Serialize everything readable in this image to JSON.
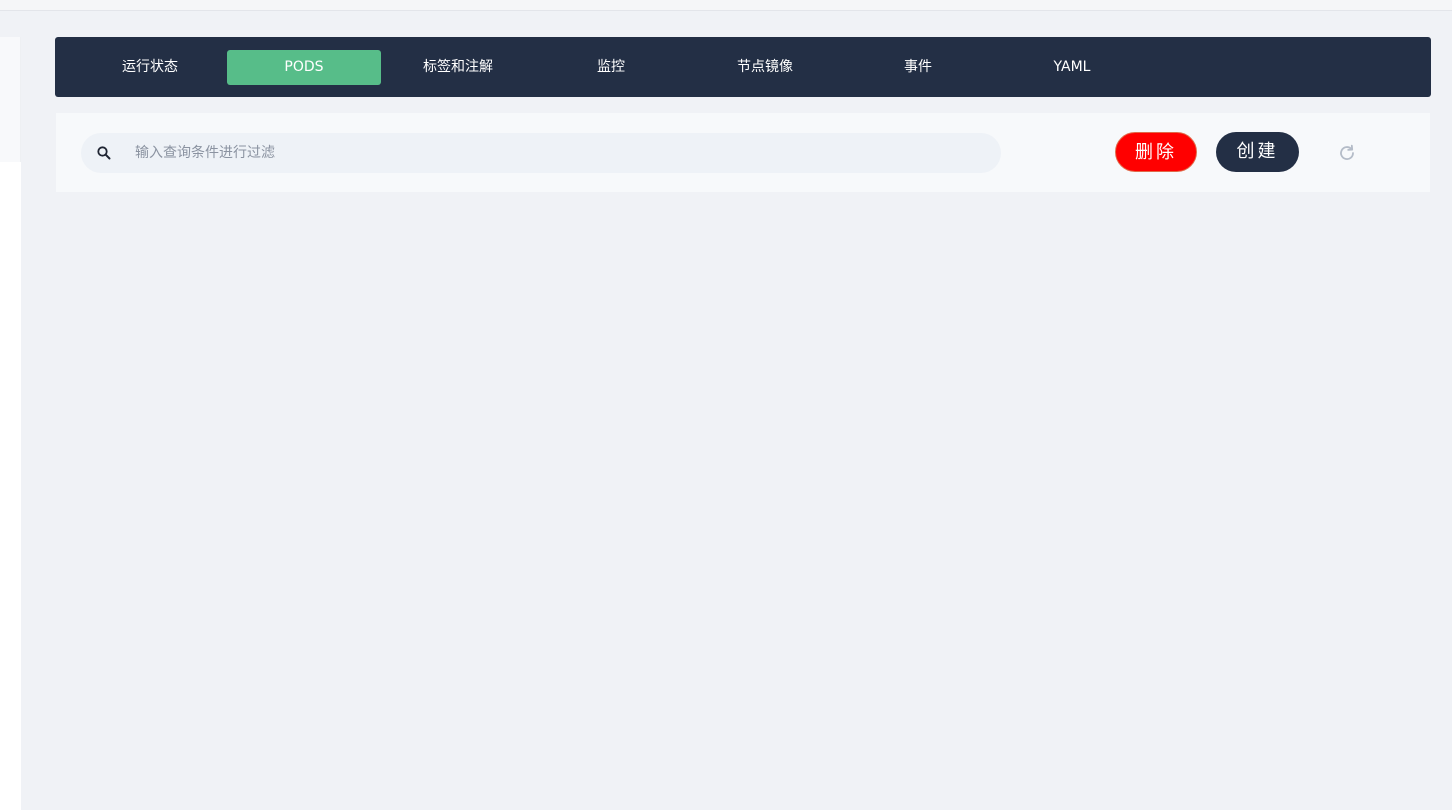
{
  "tabs": [
    {
      "label": "运行状态",
      "active": false
    },
    {
      "label": "PODS",
      "active": true
    },
    {
      "label": "标签和注解",
      "active": false
    },
    {
      "label": "监控",
      "active": false
    },
    {
      "label": "节点镜像",
      "active": false
    },
    {
      "label": "事件",
      "active": false
    },
    {
      "label": "YAML",
      "active": false
    }
  ],
  "toolbar": {
    "search_placeholder": "输入查询条件进行过滤",
    "search_value": "",
    "delete_label": "删除",
    "create_label": "创建"
  },
  "icons": {
    "search": "search-icon",
    "refresh": "refresh-icon"
  },
  "colors": {
    "tabbar_bg": "#232f45",
    "tab_active": "#57bd89",
    "delete_button": "#ff0000",
    "create_button": "#232f45",
    "page_bg": "#f0f2f6"
  }
}
